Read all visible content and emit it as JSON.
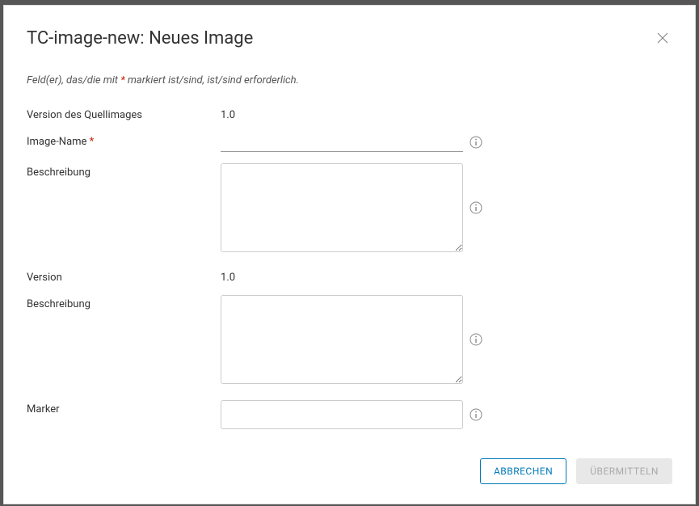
{
  "dialog": {
    "title": "TC-image-new: Neues Image",
    "hint_prefix": "Feld(er), das/die mit ",
    "hint_asterisk": "*",
    "hint_suffix": " markiert ist/sind, ist/sind erforderlich."
  },
  "fields": {
    "source_version": {
      "label": "Version des Quellimages",
      "value": "1.0"
    },
    "image_name": {
      "label": "Image-Name ",
      "required_marker": "*",
      "value": ""
    },
    "description1": {
      "label": "Beschreibung",
      "value": ""
    },
    "version": {
      "label": "Version",
      "value": "1.0"
    },
    "description2": {
      "label": "Beschreibung",
      "value": ""
    },
    "marker": {
      "label": "Marker",
      "value": ""
    }
  },
  "buttons": {
    "cancel": "Abbrechen",
    "submit": "Übermitteln"
  }
}
